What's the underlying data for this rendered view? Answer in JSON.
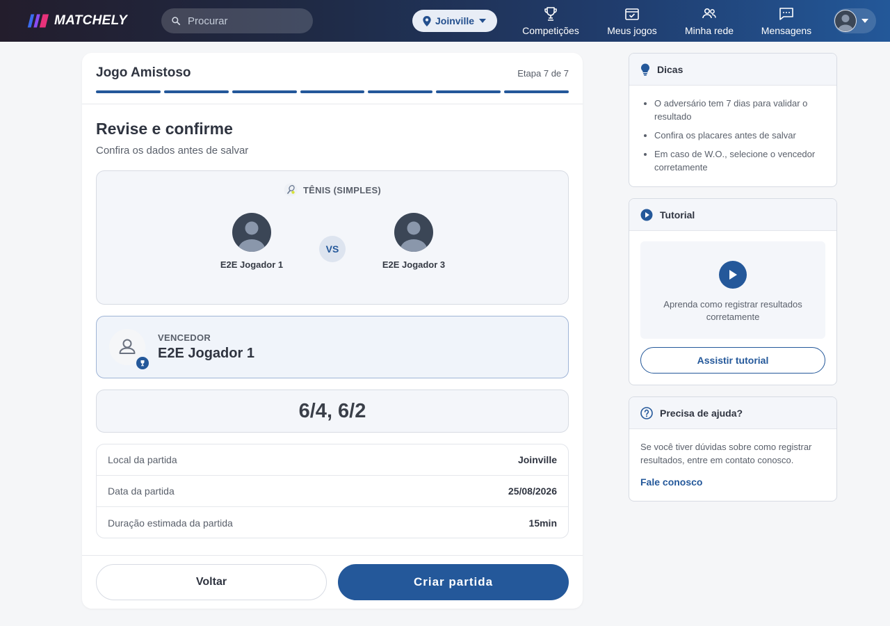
{
  "header": {
    "brand": "MATCHELY",
    "search_placeholder": "Procurar",
    "city": "Joinville",
    "nav": [
      {
        "label": "Competições",
        "icon": "trophy-icon"
      },
      {
        "label": "Meus jogos",
        "icon": "calendar-check-icon"
      },
      {
        "label": "Minha rede",
        "icon": "people-icon"
      },
      {
        "label": "Mensagens",
        "icon": "chat-icon"
      }
    ]
  },
  "wizard": {
    "title": "Jogo Amistoso",
    "step": "Etapa 7 de 7",
    "progress": {
      "completed": 7,
      "total": 7
    },
    "heading": "Revise e confirme",
    "subtitle": "Confira os dados antes de salvar"
  },
  "match": {
    "sport": "TÊNIS (SIMPLES)",
    "player1": "E2E Jogador 1",
    "vs": "VS",
    "player2": "E2E Jogador 3"
  },
  "winner": {
    "label": "VENCEDOR",
    "name": "E2E Jogador 1"
  },
  "score": "6/4, 6/2",
  "details": [
    {
      "label": "Local da partida",
      "value": "Joinville"
    },
    {
      "label": "Data da partida",
      "value": "25/08/2026"
    },
    {
      "label": "Duração estimada da partida",
      "value": "15min"
    }
  ],
  "actions": {
    "back": "Voltar",
    "create": "Criar partida"
  },
  "tips": {
    "title": "Dicas",
    "items": [
      "O adversário tem 7 dias para validar o resultado",
      "Confira os placares antes de salvar",
      "Em caso de W.O., selecione o vencedor corretamente"
    ]
  },
  "tutorial": {
    "title": "Tutorial",
    "video_text": "Aprenda como registrar resultados corretamente",
    "button": "Assistir tutorial"
  },
  "help": {
    "title": "Precisa de ajuda?",
    "text": "Se você tiver dúvidas sobre como registrar resultados, entre em contato conosco.",
    "link": "Fale conosco"
  },
  "colors": {
    "primary": "#24589a",
    "header_start": "#231d2c",
    "header_end": "#235899"
  }
}
